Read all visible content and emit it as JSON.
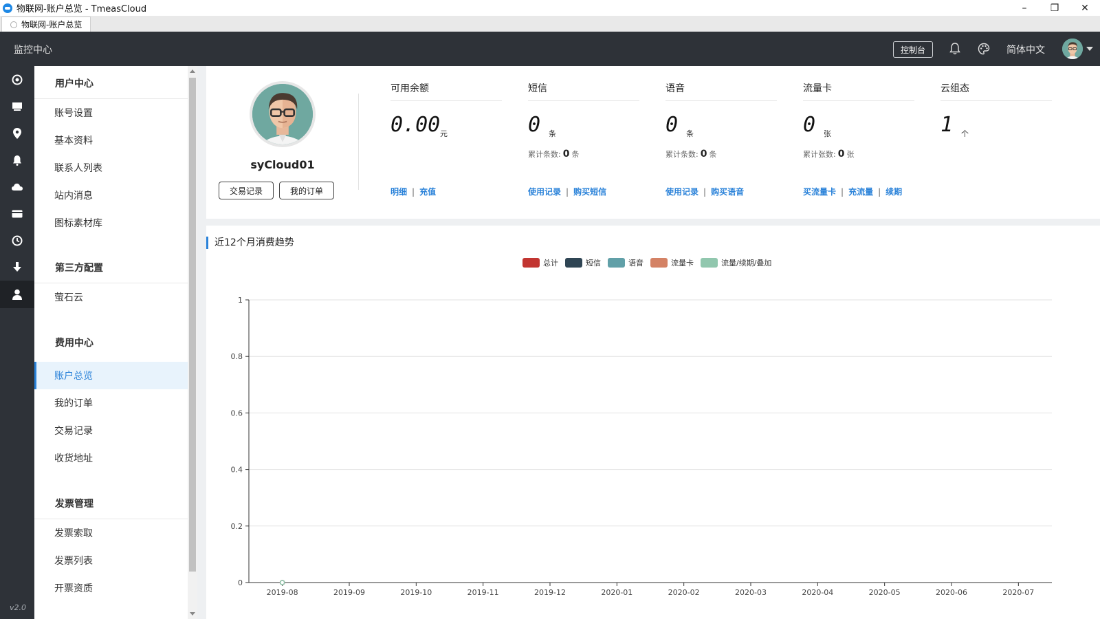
{
  "window": {
    "title": "物联网-账户总览 - TmeasCloud",
    "tab_label": "物联网-账户总览",
    "controls": [
      "minimize-icon",
      "restore-icon",
      "close-icon"
    ]
  },
  "topnav": {
    "brand": "监控中心",
    "console_label": "控制台",
    "language": "简体中文",
    "icons": [
      "bell-icon",
      "palette-icon",
      "avatar",
      "caret-down-icon"
    ]
  },
  "rail": {
    "icons": [
      "dashboard-icon",
      "monitor-icon",
      "location-icon",
      "bell-icon",
      "cloud-icon",
      "card-icon",
      "clock-icon",
      "download-icon",
      "user-icon"
    ],
    "active_index": 8,
    "version": "v2.0"
  },
  "menu": {
    "groups": [
      {
        "title": "用户中心",
        "items": [
          "账号设置",
          "基本资料",
          "联系人列表",
          "站内消息",
          "图标素材库"
        ]
      },
      {
        "title": "第三方配置",
        "items": [
          "萤石云"
        ]
      },
      {
        "title": "费用中心",
        "items": [
          "账户总览",
          "我的订单",
          "交易记录",
          "收货地址"
        ]
      },
      {
        "title": "发票管理",
        "items": [
          "发票索取",
          "发票列表",
          "开票资质"
        ]
      }
    ],
    "active_item": "账户总览"
  },
  "profile": {
    "username": "syCloud01",
    "btn_transactions": "交易记录",
    "btn_orders": "我的订单"
  },
  "stats": [
    {
      "title": "可用余额",
      "value": "0.00",
      "unit": "元",
      "sub_label": "",
      "sub_value": "",
      "sub_unit": "",
      "links": [
        "明细",
        "充值"
      ]
    },
    {
      "title": "短信",
      "value": "0",
      "unit": "条",
      "sub_label": "累计条数:",
      "sub_value": "0",
      "sub_unit": "条",
      "links": [
        "使用记录",
        "购买短信"
      ]
    },
    {
      "title": "语音",
      "value": "0",
      "unit": "条",
      "sub_label": "累计条数:",
      "sub_value": "0",
      "sub_unit": "条",
      "links": [
        "使用记录",
        "购买语音"
      ]
    },
    {
      "title": "流量卡",
      "value": "0",
      "unit": "张",
      "sub_label": "累计张数:",
      "sub_value": "0",
      "sub_unit": "张",
      "links": [
        "买流量卡",
        "充流量",
        "续期"
      ]
    },
    {
      "title": "云组态",
      "value": "1",
      "unit": "个",
      "sub_label": "",
      "sub_value": "",
      "sub_unit": "",
      "links": []
    }
  ],
  "chart_panel": {
    "title": "近12个月消费趋势"
  },
  "chart_data": {
    "type": "line",
    "title": "",
    "xlabel": "",
    "ylabel": "",
    "x": [
      "2019-08",
      "2019-09",
      "2019-10",
      "2019-11",
      "2019-12",
      "2020-01",
      "2020-02",
      "2020-03",
      "2020-04",
      "2020-05",
      "2020-06",
      "2020-07"
    ],
    "ylim": [
      0,
      1
    ],
    "yticks": [
      0,
      0.2,
      0.4,
      0.6,
      0.8,
      1
    ],
    "yticks_labels": [
      "0",
      "0.2",
      "0.4",
      "0.6",
      "0.8",
      "1"
    ],
    "grid": true,
    "legend_position": "top-center",
    "series": [
      {
        "name": "总计",
        "color": "#c23531",
        "values": [
          0,
          null,
          null,
          null,
          null,
          null,
          null,
          null,
          null,
          null,
          null,
          null
        ]
      },
      {
        "name": "短信",
        "color": "#2f4554",
        "values": [
          0,
          null,
          null,
          null,
          null,
          null,
          null,
          null,
          null,
          null,
          null,
          null
        ]
      },
      {
        "name": "语音",
        "color": "#61a0a8",
        "values": [
          0,
          null,
          null,
          null,
          null,
          null,
          null,
          null,
          null,
          null,
          null,
          null
        ]
      },
      {
        "name": "流量卡",
        "color": "#d48265",
        "values": [
          0,
          null,
          null,
          null,
          null,
          null,
          null,
          null,
          null,
          null,
          null,
          null
        ]
      },
      {
        "name": "流量/续期/叠加",
        "color": "#91c7ae",
        "values": [
          0,
          null,
          null,
          null,
          null,
          null,
          null,
          null,
          null,
          null,
          null,
          null
        ]
      }
    ]
  },
  "colors": {
    "nav_bg": "#2e3238",
    "accent": "#2a82d9",
    "active_bg": "#e8f3fc"
  }
}
